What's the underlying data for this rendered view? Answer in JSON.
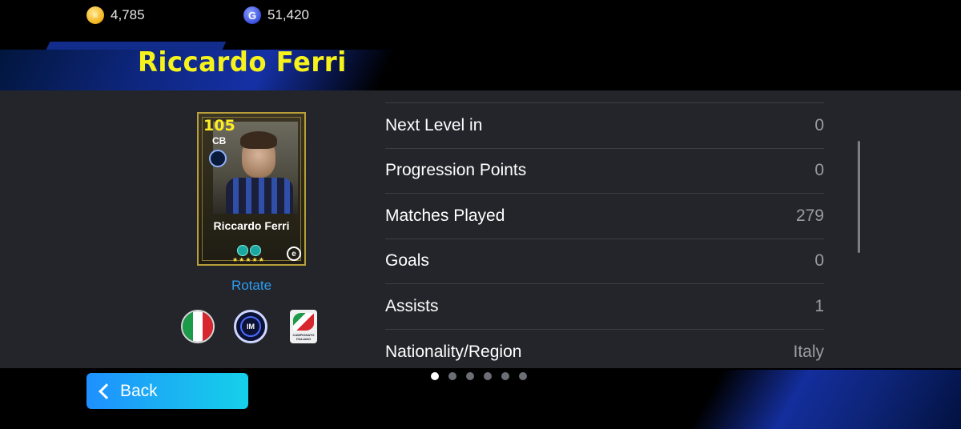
{
  "currency": {
    "coins": "4,785",
    "gp": "51,420"
  },
  "player": {
    "name_title": "Riccardo Ferri",
    "card": {
      "rating": "105",
      "position": "CB",
      "name": "Riccardo Ferri"
    }
  },
  "rotate_label": "Rotate",
  "stats": [
    {
      "label": "Next Level in",
      "value": "0"
    },
    {
      "label": "Progression Points",
      "value": "0"
    },
    {
      "label": "Matches Played",
      "value": "279"
    },
    {
      "label": "Goals",
      "value": "0"
    },
    {
      "label": "Assists",
      "value": "1"
    },
    {
      "label": "Nationality/Region",
      "value": "Italy"
    }
  ],
  "back_label": "Back",
  "pagination": {
    "total": 6,
    "active": 1
  },
  "colors": {
    "title_yellow": "#f6f21c",
    "panel_bg": "#23252b",
    "accent_blue": "#2e9cf0",
    "back_button": "#1ab8f0"
  },
  "icons": {
    "coin": "efootball-coin-icon",
    "gp": "gp-icon",
    "nationality_flag": "italy-flag-icon",
    "club": "inter-club-badge-icon",
    "league": "serie-a-league-badge-icon"
  }
}
